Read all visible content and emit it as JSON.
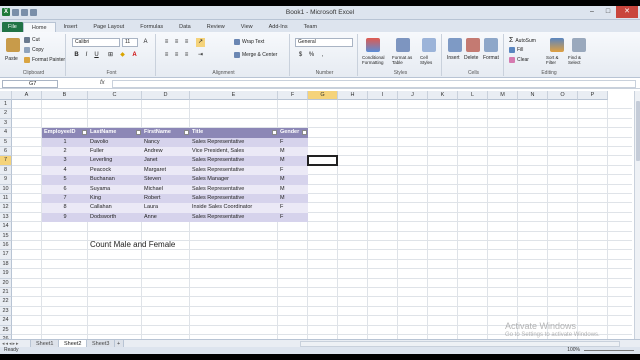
{
  "window": {
    "title": "Book1 - Microsoft Excel"
  },
  "ribbon_tabs": [
    "File",
    "Home",
    "Insert",
    "Page Layout",
    "Formulas",
    "Data",
    "Review",
    "View",
    "Add-Ins",
    "Team"
  ],
  "ribbon": {
    "clipboard": {
      "paste": "Paste",
      "cut": "Cut",
      "copy": "Copy",
      "format_painter": "Format Painter",
      "label": "Clipboard"
    },
    "font": {
      "name": "Calibri",
      "size": "11",
      "bold": "B",
      "italic": "I",
      "underline": "U",
      "label": "Font"
    },
    "alignment": {
      "wrap": "Wrap Text",
      "merge": "Merge & Center",
      "label": "Alignment"
    },
    "number": {
      "format": "General",
      "currency": "$",
      "percent": "%",
      "comma": ",",
      "label": "Number"
    },
    "styles": {
      "conditional": "Conditional Formatting",
      "format_table": "Format as Table",
      "cell_styles": "Cell Styles",
      "label": "Styles"
    },
    "cells": {
      "insert": "Insert",
      "delete": "Delete",
      "format": "Format",
      "label": "Cells"
    },
    "editing": {
      "autosum": "AutoSum",
      "fill": "Fill",
      "clear": "Clear",
      "sort": "Sort & Filter",
      "find": "Find & Select",
      "label": "Editing"
    }
  },
  "formula_bar": {
    "cell": "G7",
    "fx": "fx",
    "content": ""
  },
  "columns": [
    "A",
    "B",
    "C",
    "D",
    "E",
    "F",
    "G",
    "H",
    "I",
    "J",
    "K",
    "L",
    "M",
    "N",
    "O",
    "P"
  ],
  "rows": [
    "1",
    "2",
    "3",
    "4",
    "5",
    "6",
    "7",
    "8",
    "9",
    "10",
    "11",
    "12",
    "13",
    "14",
    "15",
    "16",
    "17",
    "18",
    "19",
    "20",
    "21",
    "22",
    "23",
    "24",
    "25",
    "26"
  ],
  "table": {
    "headers": [
      "EmployeeID",
      "LastName",
      "FirstName",
      "Title",
      "Gender"
    ],
    "rows": [
      [
        "1",
        "Davolio",
        "Nancy",
        "Sales Representative",
        "F"
      ],
      [
        "2",
        "Fuller",
        "Andrew",
        "Vice President, Sales",
        "M"
      ],
      [
        "3",
        "Leverling",
        "Janet",
        "Sales Representative",
        "M"
      ],
      [
        "4",
        "Peacock",
        "Margaret",
        "Sales Representative",
        "F"
      ],
      [
        "5",
        "Buchanan",
        "Steven",
        "Sales Manager",
        "M"
      ],
      [
        "6",
        "Suyama",
        "Michael",
        "Sales Representative",
        "M"
      ],
      [
        "7",
        "King",
        "Robert",
        "Sales Representative",
        "M"
      ],
      [
        "8",
        "Callahan",
        "Laura",
        "Inside Sales Coordinator",
        "F"
      ],
      [
        "9",
        "Dodsworth",
        "Anne",
        "Sales Representative",
        "F"
      ]
    ]
  },
  "note": "Count Male and Female",
  "sheets": [
    "Sheet1",
    "Sheet2",
    "Sheet3"
  ],
  "active_sheet": "Sheet2",
  "status": {
    "ready": "Ready",
    "zoom": "100%"
  },
  "watermark": {
    "line1": "Activate Windows",
    "line2": "Go to Settings to activate Windows."
  },
  "colors": {
    "table_header": "#8c87b6",
    "band_dark": "#d6d3ec",
    "band_light": "#ebe9f6",
    "file_tab": "#217346"
  }
}
